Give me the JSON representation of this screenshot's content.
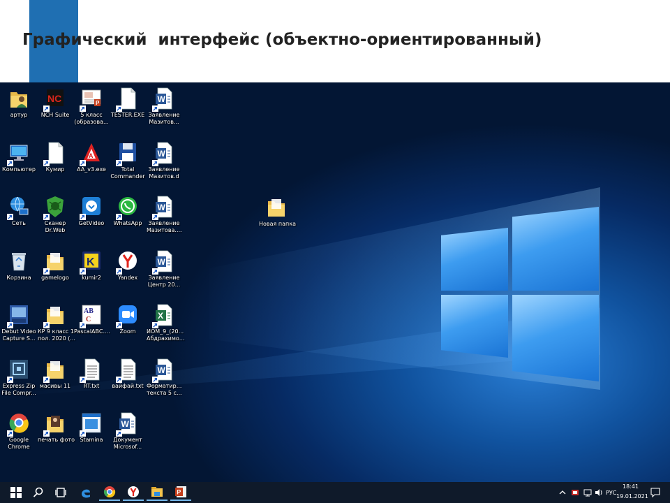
{
  "slide": {
    "title": "Графический  интерфейс (объектно-ориентированный)"
  },
  "desktop": {
    "icons": [
      {
        "label": "артур",
        "icon": "user-folder-icon"
      },
      {
        "label": "NCH Suite",
        "icon": "nch-suite-icon"
      },
      {
        "label": "5 класс\n(образова...",
        "icon": "powerpoint-file-icon"
      },
      {
        "label": "TESTER.EXE",
        "icon": "blank-file-icon"
      },
      {
        "label": "Заявление\nМазитов...",
        "icon": "word-document-icon"
      },
      {
        "label": "Компьютер",
        "icon": "computer-icon"
      },
      {
        "label": "Кумир",
        "icon": "blank-file-icon"
      },
      {
        "label": "AA_v3.exe",
        "icon": "ammyy-admin-icon"
      },
      {
        "label": "Total\nCommander",
        "icon": "floppy-disk-icon"
      },
      {
        "label": "Заявление\nМазитов.d",
        "icon": "word-document-icon"
      },
      {
        "label": "Сеть",
        "icon": "network-globe-icon"
      },
      {
        "label": "Сканер\nDr.Web",
        "icon": "drweb-scanner-icon"
      },
      {
        "label": "GetVideo",
        "icon": "getvideo-icon"
      },
      {
        "label": "WhatsApp",
        "icon": "whatsapp-icon"
      },
      {
        "label": "Заявление\nМазитова....",
        "icon": "word-document-icon"
      },
      {
        "label": "Корзина",
        "icon": "recycle-bin-icon"
      },
      {
        "label": "gamelogo",
        "icon": "folder-icon"
      },
      {
        "label": "kumir2",
        "icon": "kumir2-icon"
      },
      {
        "label": "Yandex",
        "icon": "yandex-browser-icon"
      },
      {
        "label": "Заявление\nЦентр 20...",
        "icon": "word-document-icon"
      },
      {
        "label": "Debut Video\nCapture S...",
        "icon": "debut-video-icon"
      },
      {
        "label": "КР 9 класс 1\nпол. 2020 (...",
        "icon": "folder-icon"
      },
      {
        "label": "PascalABC....",
        "icon": "pascalabc-icon"
      },
      {
        "label": "Zoom",
        "icon": "zoom-icon"
      },
      {
        "label": "ИОМ_9_(20...\nАбдрахимо...",
        "icon": "excel-file-icon"
      },
      {
        "label": "Express Zip\nFile Compr...",
        "icon": "express-zip-icon"
      },
      {
        "label": "масивы 11",
        "icon": "folder-icon"
      },
      {
        "label": "RT.txt",
        "icon": "text-file-icon"
      },
      {
        "label": "вайфай.txt",
        "icon": "text-file-icon"
      },
      {
        "label": "Форматир...\nтекста 5 с...",
        "icon": "word-document-icon"
      },
      {
        "label": "Google\nChrome",
        "icon": "chrome-icon"
      },
      {
        "label": "печать фото",
        "icon": "photo-folder-icon"
      },
      {
        "label": "Stamina",
        "icon": "stamina-icon"
      },
      {
        "label": "Документ\nMicrosof...",
        "icon": "word-document-icon"
      },
      {
        "label": "",
        "icon": ""
      },
      {
        "label": "Новая папка",
        "icon": "folder-icon"
      }
    ]
  },
  "taskbar": {
    "pinned": [
      {
        "name": "start-button",
        "icon": "windows-logo-icon"
      },
      {
        "name": "search-button",
        "icon": "search-icon"
      },
      {
        "name": "task-view-button",
        "icon": "task-view-icon"
      },
      {
        "name": "edge-button",
        "icon": "edge-icon"
      },
      {
        "name": "chrome-button",
        "icon": "chrome-icon"
      },
      {
        "name": "yandex-button",
        "icon": "yandex-browser-icon"
      },
      {
        "name": "explorer-button",
        "icon": "file-explorer-icon"
      },
      {
        "name": "powerpoint-button",
        "icon": "powerpoint-icon"
      }
    ],
    "tray": {
      "language": "РУС",
      "time": "18:41",
      "date": "19.01.2021"
    }
  },
  "colors": {
    "accent": "#1f6fb2",
    "taskbar": "#0f1a2a",
    "wallpaper_dark": "#062a63",
    "wallpaper_light": "#3d9cf0"
  }
}
